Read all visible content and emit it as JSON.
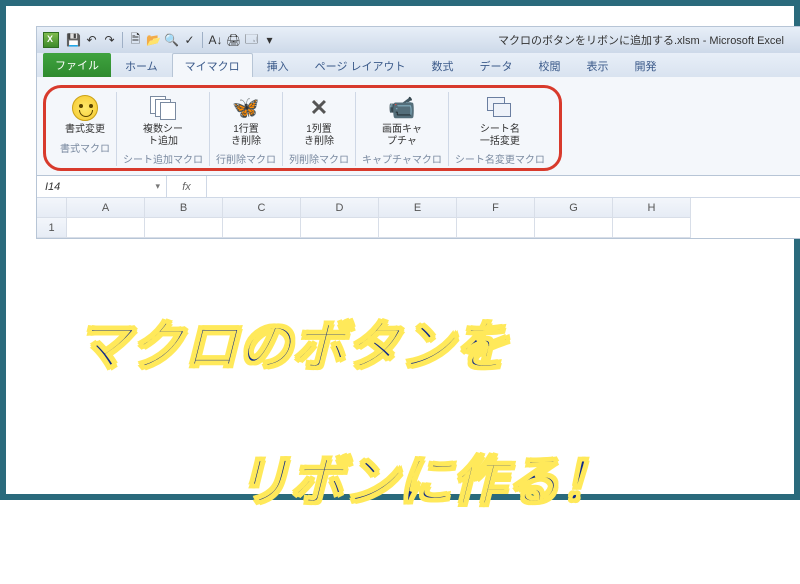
{
  "title_bar": {
    "filename": "マクロのボタンをリボンに追加する.xlsm - Microsoft Excel"
  },
  "tabs": {
    "file": "ファイル",
    "home": "ホーム",
    "mymacro": "マイマクロ",
    "insert": "挿入",
    "pagelayout": "ページ レイアウト",
    "formulas": "数式",
    "data": "データ",
    "review": "校閲",
    "view": "表示",
    "developer": "開発"
  },
  "ribbon": {
    "groups": [
      {
        "btn_label": "書式変更",
        "group_label": "書式マクロ",
        "icon": "smiley"
      },
      {
        "btn_label": "複数シー\nト追加",
        "group_label": "シート追加マクロ",
        "icon": "copies"
      },
      {
        "btn_label": "1行置\nき削除",
        "group_label": "行削除マクロ",
        "icon": "butterfly"
      },
      {
        "btn_label": "1列置\nき削除",
        "group_label": "列削除マクロ",
        "icon": "xmark"
      },
      {
        "btn_label": "画面キャ\nプチャ",
        "group_label": "キャプチャマクロ",
        "icon": "camcorder"
      },
      {
        "btn_label": "シート名\n一括変更",
        "group_label": "シート名変更マクロ",
        "icon": "stackwin"
      }
    ]
  },
  "formula_bar": {
    "name_box": "I14",
    "fx": "fx"
  },
  "columns": [
    "A",
    "B",
    "C",
    "D",
    "E",
    "F",
    "G",
    "H"
  ],
  "rows": [
    "1"
  ],
  "headline": {
    "line1": "マクロのボタンを",
    "line2": "リボンに作る！"
  }
}
